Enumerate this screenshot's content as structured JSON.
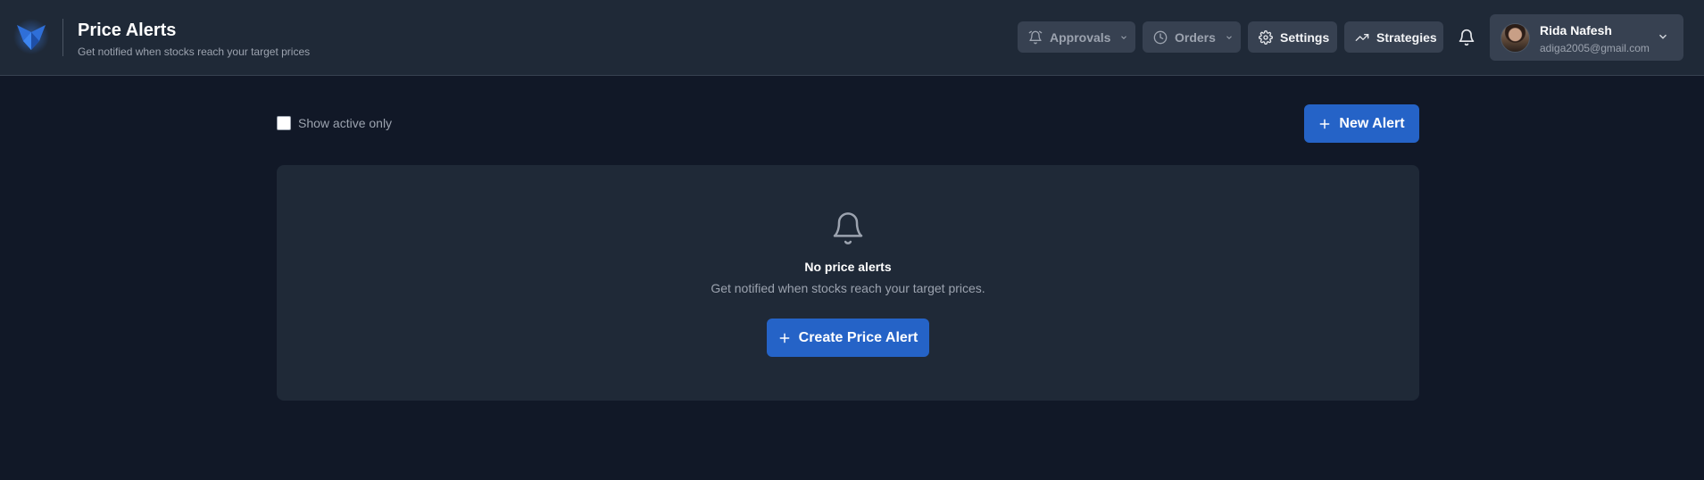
{
  "header": {
    "title": "Price Alerts",
    "subtitle": "Get notified when stocks reach your target prices",
    "logo_icon": "brand-logo-icon",
    "nav": [
      {
        "label": "Approvals",
        "icon": "alarm-bell-icon"
      },
      {
        "label": "Orders",
        "icon": "clock-icon"
      },
      {
        "label": "Settings",
        "icon": "gear-icon"
      },
      {
        "label": "Strategies",
        "icon": "trending-up-icon"
      }
    ],
    "notifications_icon": "bell-icon",
    "user": {
      "name": "Rida Nafesh",
      "email": "adiga2005@gmail.com"
    }
  },
  "toolbar": {
    "show_active_label": "Show active only",
    "show_active_checked": false,
    "new_alert_label": "New Alert"
  },
  "empty_state": {
    "icon": "bell-icon",
    "title": "No price alerts",
    "description": "Get notified when stocks reach your target prices.",
    "button_label": "Create Price Alert"
  },
  "colors": {
    "background": "#111827",
    "surface": "#1f2937",
    "control": "#374151",
    "accent": "#2563c7",
    "muted_text": "#9ca3af"
  }
}
